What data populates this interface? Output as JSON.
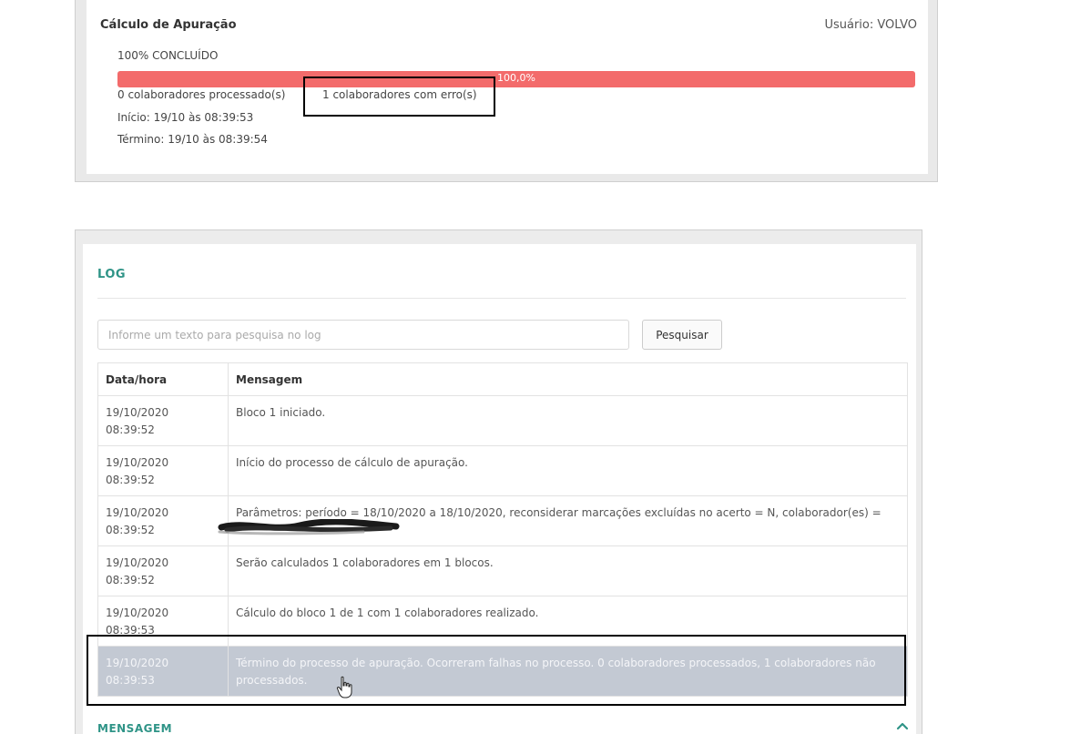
{
  "apuracao": {
    "title": "Cálculo de Apuração",
    "user": "Usuário: VOLVO",
    "status": "100% CONCLUÍDO",
    "progress_label": "100,0%",
    "progress_fraction": 1.0,
    "processed": "0 colaboradores processado(s)",
    "errors": "1 colaboradores com erro(s)",
    "inicio": "Início: 19/10 às 08:39:53",
    "termino": "Término: 19/10 às 08:39:54"
  },
  "log": {
    "title": "LOG",
    "search_placeholder": "Informe um texto para pesquisa no log",
    "search_button": "Pesquisar",
    "columns": [
      "Data/hora",
      "Mensagem"
    ],
    "rows": [
      {
        "date": "19/10/2020",
        "time": "08:39:52",
        "message": "Bloco 1 iniciado."
      },
      {
        "date": "19/10/2020",
        "time": "08:39:52",
        "message": "Início do processo de cálculo de apuração."
      },
      {
        "date": "19/10/2020",
        "time": "08:39:52",
        "message": "Parâmetros: período = 18/10/2020 a 18/10/2020, reconsiderar marcações excluídas no acerto = N, colaborador(es) ="
      },
      {
        "date": "19/10/2020",
        "time": "08:39:52",
        "message": "Serão calculados 1 colaboradores em 1 blocos."
      },
      {
        "date": "19/10/2020",
        "time": "08:39:53",
        "message": "Cálculo do bloco 1 de 1 com 1 colaboradores realizado."
      },
      {
        "date": "19/10/2020",
        "time": "08:39:53",
        "message": "Término do processo de apuração. Ocorreram falhas no processo. 0 colaboradores processados, 1 colaboradores não processados."
      }
    ],
    "mensagem_label": "MENSAGEM"
  },
  "colors": {
    "progress": "#f36b6b",
    "accent": "#2f9487",
    "selected_row": "#c3c9d3"
  },
  "icons": {
    "collapse": "chevron-up-icon",
    "cursor": "hand-pointer-icon"
  }
}
